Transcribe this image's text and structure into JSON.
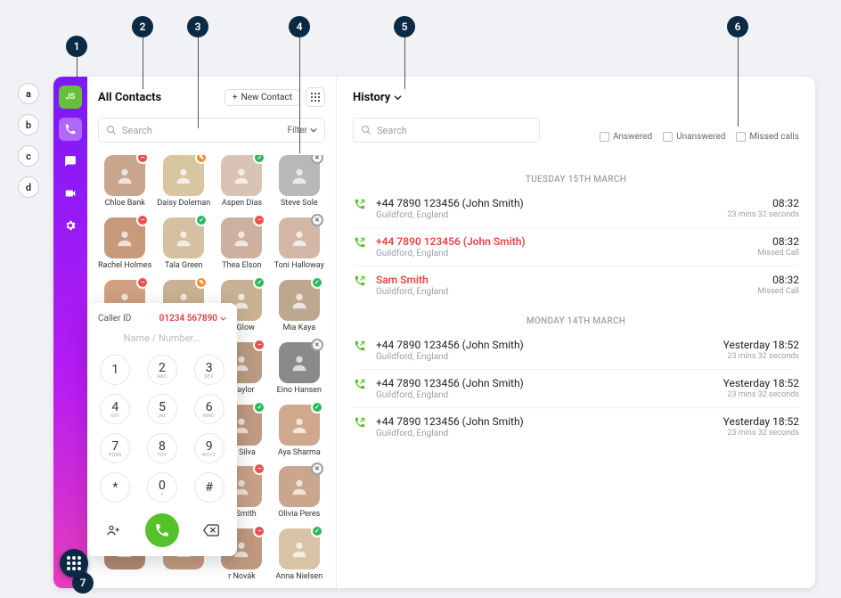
{
  "callouts": {
    "n1": "1",
    "n2": "2",
    "n3": "3",
    "n4": "4",
    "n5": "5",
    "n6": "6",
    "n7": "7",
    "la": "a",
    "lb": "b",
    "lc": "c",
    "ld": "d"
  },
  "sidebar": {
    "initials": "JS"
  },
  "contacts": {
    "title": "All Contacts",
    "new_btn": "New Contact",
    "search_placeholder": "Search",
    "filter_label": "Filter",
    "items": [
      {
        "name": "Chloe Bank",
        "badge": "red",
        "color": "#c9a58d"
      },
      {
        "name": "Daisy Doleman",
        "badge": "orange",
        "color": "#d7c6a0"
      },
      {
        "name": "Aspen Dias",
        "badge": "green",
        "color": "#d8c3b5"
      },
      {
        "name": "Steve Sole",
        "badge": "gray",
        "color": "#b8b8b8"
      },
      {
        "name": "Rachel Holmes",
        "badge": "red",
        "color": "#c79a7c"
      },
      {
        "name": "Tala Green",
        "badge": "green",
        "color": "#d6c0a2"
      },
      {
        "name": "Thea Elson",
        "badge": "red",
        "color": "#cdb0a0"
      },
      {
        "name": "Toni Halloway",
        "badge": "gray",
        "color": "#d4b6a6"
      },
      {
        "name": "",
        "badge": "red",
        "color": "#d0a080"
      },
      {
        "name": "",
        "badge": "orange",
        "color": "#c9b293"
      },
      {
        "name": "ly Glow",
        "badge": "green",
        "color": "#c9b293"
      },
      {
        "name": "Mia Kaya",
        "badge": "green",
        "color": "#bda88f"
      },
      {
        "name": "",
        "badge": "red",
        "color": "#caa78b"
      },
      {
        "name": "",
        "badge": "orange",
        "color": "#c69f86"
      },
      {
        "name": "l Taylor",
        "badge": "red",
        "color": "#b99c82"
      },
      {
        "name": "Eino Hansen",
        "badge": "gray",
        "color": "#8a8a8a"
      },
      {
        "name": "",
        "badge": "green",
        "color": "#caa288"
      },
      {
        "name": "",
        "badge": "green",
        "color": "#b58e78"
      },
      {
        "name": "ne Silva",
        "badge": "green",
        "color": "#c19a81"
      },
      {
        "name": "Aya Sharma",
        "badge": "green",
        "color": "#cfa88e"
      },
      {
        "name": "",
        "badge": "red",
        "color": "#ba9078"
      },
      {
        "name": "",
        "badge": "green",
        "color": "#4a4a4a"
      },
      {
        "name": "ia Smith",
        "badge": "red",
        "color": "#c7a187"
      },
      {
        "name": "Olivia Peres",
        "badge": "gray",
        "color": "#caa68d"
      },
      {
        "name": "",
        "badge": "green",
        "color": "#b08a72"
      },
      {
        "name": "",
        "badge": "green",
        "color": "#c49c82"
      },
      {
        "name": "r Novák",
        "badge": "red",
        "color": "#bf987e"
      },
      {
        "name": "Anna Nielsen",
        "badge": "green",
        "color": "#d9c3a6"
      }
    ]
  },
  "history": {
    "title": "History",
    "search_placeholder": "Search",
    "filters": {
      "answered": "Answered",
      "unanswered": "Unanswered",
      "missed": "Missed calls"
    },
    "groups": [
      {
        "date": "TUESDAY 15TH MARCH",
        "rows": [
          {
            "title": "+44 7890 123456 (John Smith)",
            "sub": "Guildford, England",
            "time": "08:32",
            "dur": "23 mins 32 seconds",
            "missed": false
          },
          {
            "title": "+44 7890 123456 (John Smith)",
            "sub": "Guildford, England",
            "time": "08:32",
            "dur": "Missed Call",
            "missed": true
          },
          {
            "title": "Sam Smith",
            "sub": "Guildford, England",
            "time": "08:32",
            "dur": "Missed Call",
            "missed": true
          }
        ]
      },
      {
        "date": "MONDAY 14TH MARCH",
        "rows": [
          {
            "title": "+44 7890 123456 (John Smith)",
            "sub": "Guildford, England",
            "time": "Yesterday 18:52",
            "dur": "23 mins 32 seconds",
            "missed": false
          },
          {
            "title": "+44 7890 123456 (John Smith)",
            "sub": "Guildford, England",
            "time": "Yesterday 18:52",
            "dur": "23 mins 32 seconds",
            "missed": false
          },
          {
            "title": "+44 7890 123456 (John Smith)",
            "sub": "Guildford, England",
            "time": "Yesterday 18:52",
            "dur": "23 mins 32 seconds",
            "missed": false
          }
        ]
      }
    ]
  },
  "dialer": {
    "caller_id_label": "Caller ID",
    "caller_id_value": "01234 567890",
    "placeholder": "Name / Number...",
    "keys": [
      {
        "d": "1",
        "s": ""
      },
      {
        "d": "2",
        "s": "ABC"
      },
      {
        "d": "3",
        "s": "DEF"
      },
      {
        "d": "4",
        "s": "GHI"
      },
      {
        "d": "5",
        "s": "JKL"
      },
      {
        "d": "6",
        "s": "MNO"
      },
      {
        "d": "7",
        "s": "PQRS"
      },
      {
        "d": "8",
        "s": "TUV"
      },
      {
        "d": "9",
        "s": "WXYZ"
      },
      {
        "d": "*",
        "s": ""
      },
      {
        "d": "0",
        "s": "+"
      },
      {
        "d": "#",
        "s": ""
      }
    ]
  }
}
